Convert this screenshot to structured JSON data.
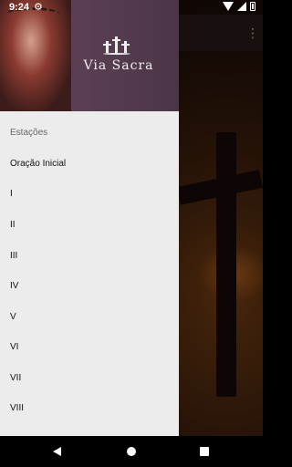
{
  "status_bar": {
    "time": "9:24",
    "settings_icon": "gear-icon"
  },
  "drawer": {
    "title": "Via Sacra",
    "subheader": "Estações",
    "items": [
      {
        "label": "Oração Inicial"
      },
      {
        "label": "I"
      },
      {
        "label": "II"
      },
      {
        "label": "III"
      },
      {
        "label": "IV"
      },
      {
        "label": "V"
      },
      {
        "label": "VI"
      },
      {
        "label": "VII"
      },
      {
        "label": "VIII"
      }
    ]
  },
  "app_bar": {
    "overflow_icon": "more-vert-icon"
  },
  "nav_bar": {
    "back_icon": "back-icon",
    "home_icon": "home-icon",
    "recents_icon": "recents-icon"
  }
}
